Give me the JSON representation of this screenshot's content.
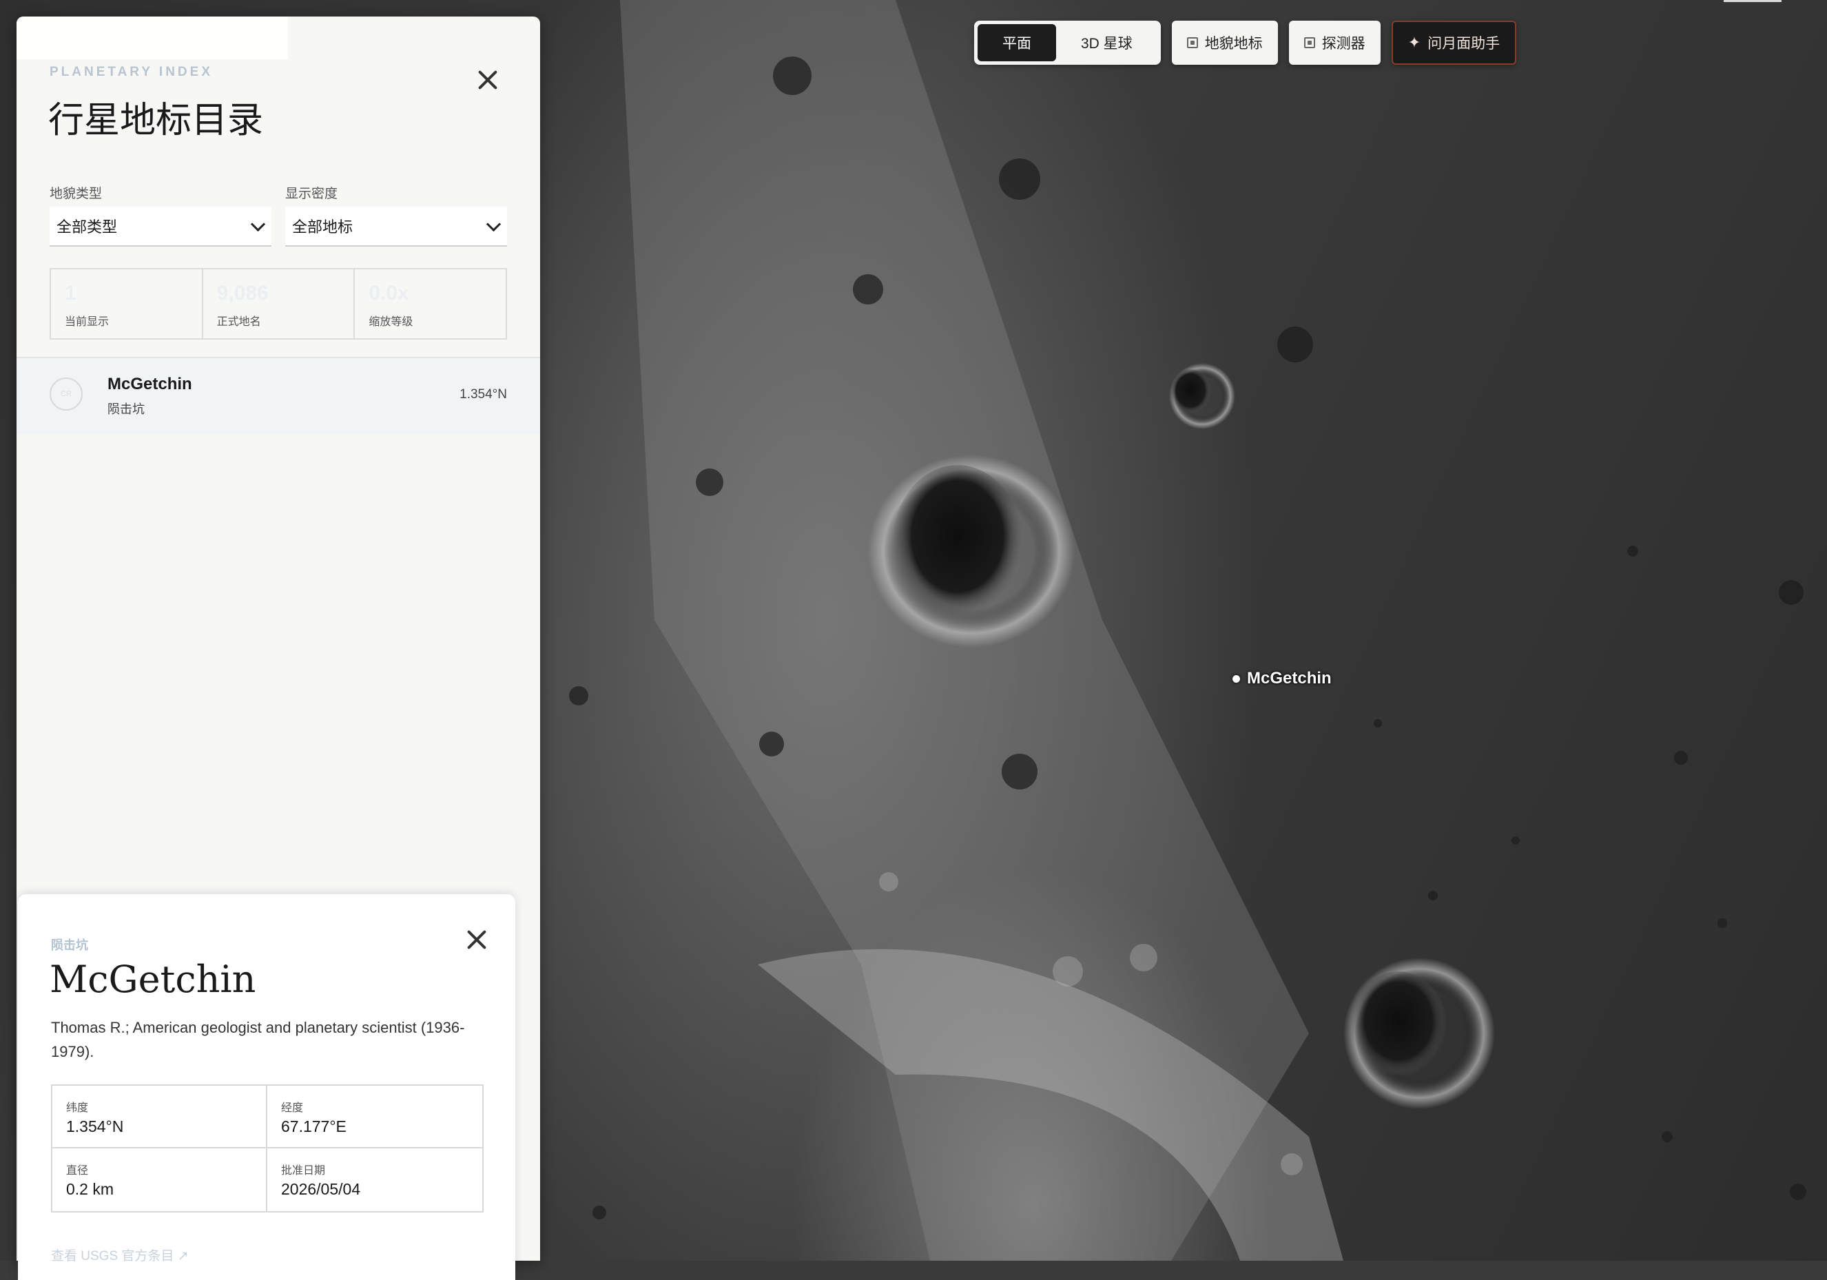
{
  "toolbar": {
    "view_modes": [
      "平面",
      "3D 星球"
    ],
    "active_view": "平面",
    "landforms_label": "地貌地标",
    "probes_label": "探测器",
    "assistant_label": "问月面助手"
  },
  "panel": {
    "eyebrow": "PLANETARY INDEX",
    "title": "行星地标目录",
    "filters": {
      "type_label": "地貌类型",
      "type_value": "全部类型",
      "density_label": "显示密度",
      "density_value": "全部地标"
    },
    "stats": [
      {
        "value": "1",
        "label": "当前显示"
      },
      {
        "value": "9,086",
        "label": "正式地名"
      },
      {
        "value": "0.0x",
        "label": "缩放等级"
      }
    ],
    "list": [
      {
        "badge": "CR",
        "name": "McGetchin",
        "type": "陨击坑",
        "lat": "1.354°N"
      }
    ]
  },
  "detail": {
    "type": "陨击坑",
    "name": "McGetchin",
    "description": "Thomas R.; American geologist and planetary scientist (1936-1979).",
    "fields": [
      {
        "label": "纬度",
        "value": "1.354°N"
      },
      {
        "label": "经度",
        "value": "67.177°E"
      },
      {
        "label": "直径",
        "value": "0.2 km"
      },
      {
        "label": "批准日期",
        "value": "2026/05/04"
      }
    ],
    "link": "查看 USGS 官方条目 ↗"
  },
  "map": {
    "marker_label": "McGetchin"
  }
}
